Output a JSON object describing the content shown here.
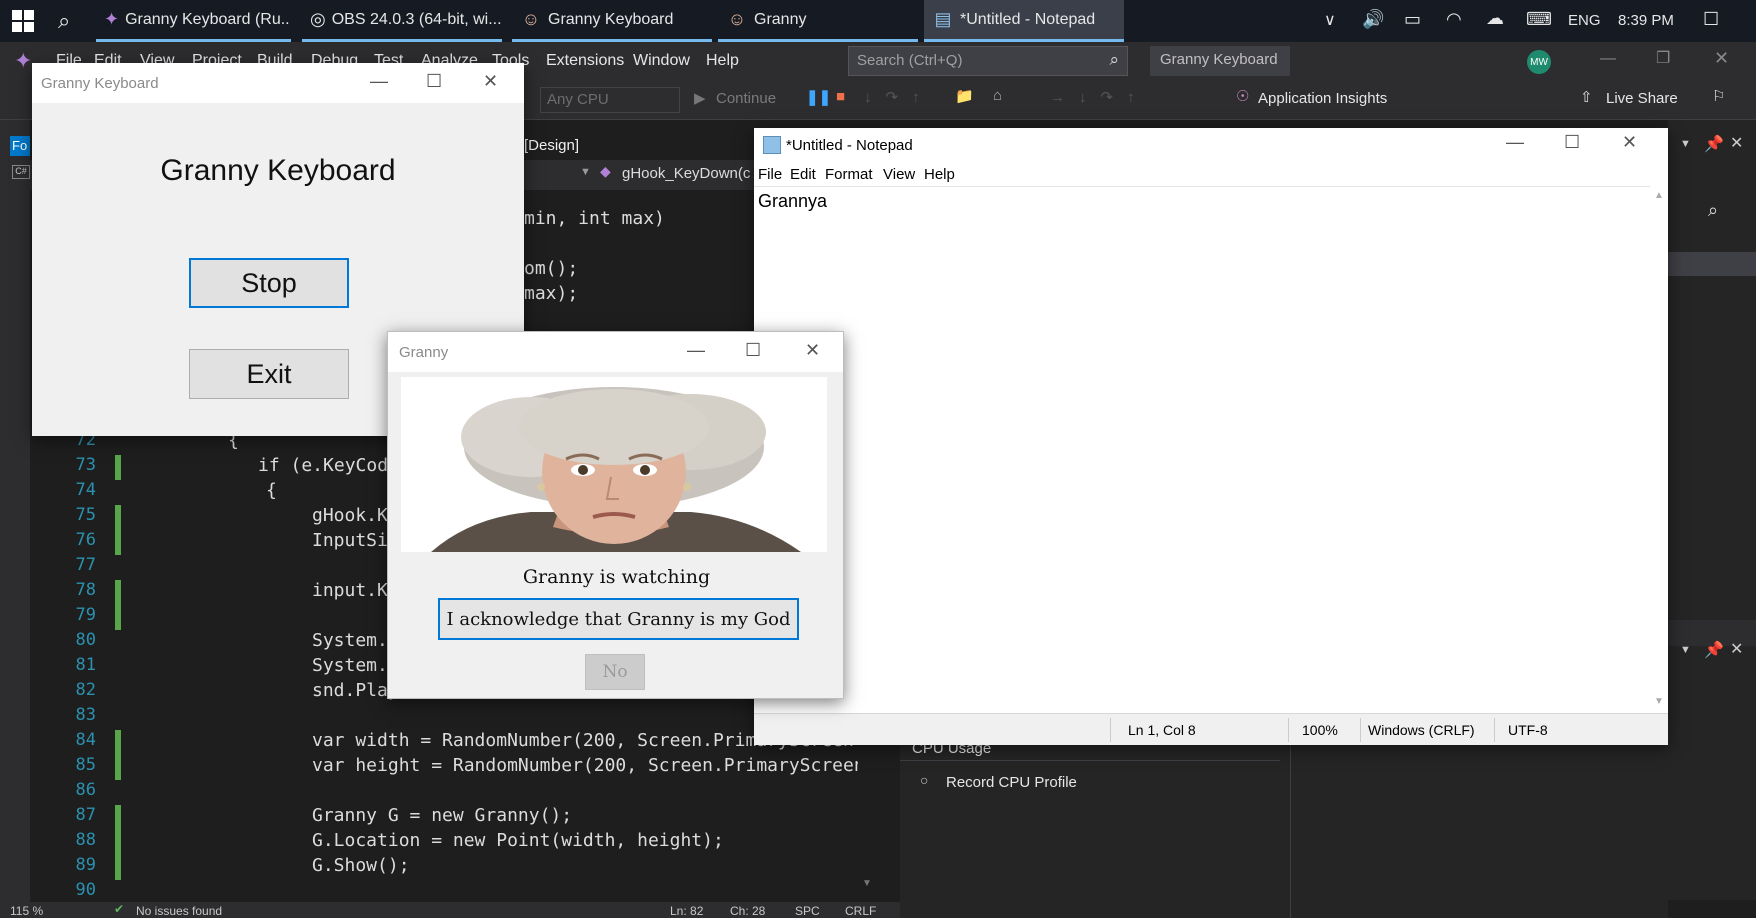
{
  "taskbar": {
    "items": [
      {
        "label": "Granny Keyboard (Ru...",
        "icon": "visual-studio-icon"
      },
      {
        "label": "OBS 24.0.3 (64-bit, wi...",
        "icon": "obs-icon"
      },
      {
        "label": "Granny Keyboard",
        "icon": "granny-icon"
      },
      {
        "label": "Granny",
        "icon": "granny-icon"
      },
      {
        "label": "*Untitled - Notepad",
        "icon": "notepad-icon"
      }
    ],
    "language": "ENG",
    "time": "8:39 PM"
  },
  "vs": {
    "menu": [
      "File",
      "Edit",
      "View",
      "Project",
      "Build",
      "Debug",
      "Test",
      "Analyze",
      "Tools",
      "Extensions",
      "Window",
      "Help"
    ],
    "search_placeholder": "Search (Ctrl+Q)",
    "solution_name": "Granny Keyboard",
    "avatar_initials": "MW",
    "toolbar": {
      "platform": "Any CPU",
      "continue": "Continue",
      "app_insights": "Application Insights",
      "live_share": "Live Share"
    },
    "tab_design": "[Design]",
    "nav_member": "gHook_KeyDown(c",
    "left_tab": "Fo",
    "code_fragments": {
      "sig": "min, int max)",
      "rnd1": "om();",
      "rnd2": "max);"
    },
    "lines": [
      {
        "n": "72",
        "text": "{"
      },
      {
        "n": "73",
        "text": "if (e.KeyCod"
      },
      {
        "n": "74",
        "text": "{"
      },
      {
        "n": "75",
        "text": "gHook.K"
      },
      {
        "n": "76",
        "text": "InputSi"
      },
      {
        "n": "77",
        "text": ""
      },
      {
        "n": "78",
        "text": "input.K"
      },
      {
        "n": "79",
        "text": ""
      },
      {
        "n": "80",
        "text": "System."
      },
      {
        "n": "81",
        "text": "System."
      },
      {
        "n": "82",
        "text": "snd.Play();"
      },
      {
        "n": "83",
        "text": ""
      },
      {
        "n": "84",
        "text": "var width = RandomNumber(200, Screen.PrimaryScreen."
      },
      {
        "n": "85",
        "text": "var height = RandomNumber(200, Screen.PrimaryScreen."
      },
      {
        "n": "86",
        "text": ""
      },
      {
        "n": "87",
        "text": "Granny G = new Granny();"
      },
      {
        "n": "88",
        "text": "G.Location = new Point(width, height);"
      },
      {
        "n": "89",
        "text": "G.Show();"
      },
      {
        "n": "90",
        "text": ""
      }
    ],
    "status": {
      "zoom": "115 %",
      "issues": "No issues found",
      "ln": "Ln: 82",
      "ch": "Ch: 28",
      "spc": "SPC",
      "crlf": "CRLF"
    },
    "diagnostics": {
      "cpu_usage": "CPU Usage",
      "record": "Record CPU Profile"
    }
  },
  "granny_keyboard": {
    "title": "Granny Keyboard",
    "heading": "Granny Keyboard",
    "stop": "Stop",
    "exit": "Exit"
  },
  "granny": {
    "title": "Granny",
    "caption": "Granny is watching",
    "acknowledge": "I acknowledge that Granny is my God",
    "no": "No"
  },
  "notepad": {
    "title": "*Untitled - Notepad",
    "menu": [
      "File",
      "Edit",
      "Format",
      "View",
      "Help"
    ],
    "content": "Grannya",
    "status": {
      "position": "Ln 1, Col 8",
      "zoom": "100%",
      "eol": "Windows (CRLF)",
      "encoding": "UTF-8"
    }
  }
}
